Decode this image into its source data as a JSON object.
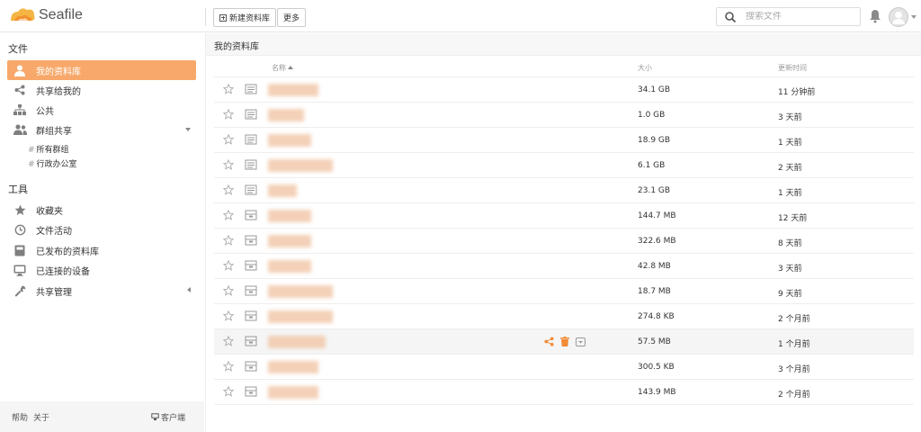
{
  "app": {
    "logo_text": "Seafile"
  },
  "toolbar": {
    "new_library": "新建资料库",
    "more": "更多"
  },
  "search": {
    "placeholder": "搜索文件"
  },
  "sidebar": {
    "files_heading": "文件",
    "tools_heading": "工具",
    "items": [
      {
        "label": "我的资料库",
        "icon": "user-icon",
        "active": true
      },
      {
        "label": "共享给我的",
        "icon": "share-icon"
      },
      {
        "label": "公共",
        "icon": "sitemap-icon"
      },
      {
        "label": "群组共享",
        "icon": "group-icon"
      }
    ],
    "group_sub": [
      "所有群组",
      "行政办公室"
    ],
    "tools": [
      {
        "label": "收藏夹",
        "icon": "star-icon"
      },
      {
        "label": "文件活动",
        "icon": "history-icon"
      },
      {
        "label": "已发布的资料库",
        "icon": "book-icon"
      },
      {
        "label": "已连接的设备",
        "icon": "monitor-icon"
      },
      {
        "label": "共享管理",
        "icon": "wrench-icon"
      }
    ],
    "footer": {
      "help": "帮助",
      "about": "关于",
      "client": "客户端"
    }
  },
  "main": {
    "breadcrumb": "我的资料库",
    "columns": {
      "name": "名称",
      "size": "大小",
      "time": "更新时间"
    },
    "rows": [
      {
        "size": "34.1 GB",
        "time": "11 分钟前"
      },
      {
        "size": "1.0 GB",
        "time": "3 天前"
      },
      {
        "size": "18.9 GB",
        "time": "1 天前"
      },
      {
        "size": "6.1 GB",
        "time": "2 天前"
      },
      {
        "size": "23.1 GB",
        "time": "1 天前"
      },
      {
        "size": "144.7 MB",
        "time": "12 天前"
      },
      {
        "size": "322.6 MB",
        "time": "8 天前"
      },
      {
        "size": "42.8 MB",
        "time": "3 天前"
      },
      {
        "size": "18.7 MB",
        "time": "9 天前"
      },
      {
        "size": "274.8 KB",
        "time": "2 个月前"
      },
      {
        "size": "57.5 MB",
        "time": "1 个月前",
        "hover": true
      },
      {
        "size": "300.5 KB",
        "time": "3 个月前"
      },
      {
        "size": "143.9 MB",
        "time": "2 个月前"
      }
    ]
  },
  "colors": {
    "accent": "#f7a86a",
    "op_icon": "#f28a35"
  }
}
